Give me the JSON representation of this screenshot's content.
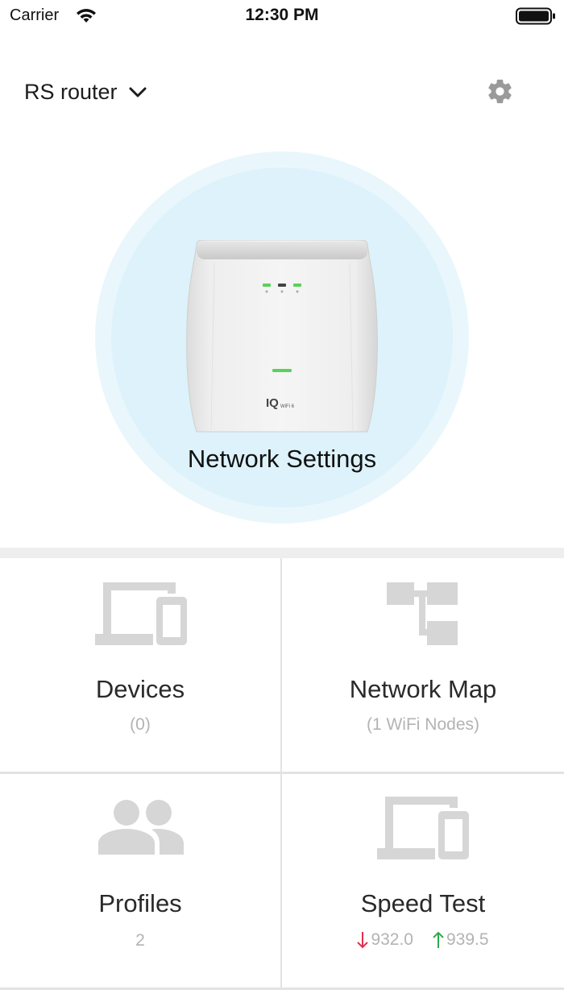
{
  "status_bar": {
    "carrier": "Carrier",
    "time": "12:30 PM",
    "icons": [
      "wifi-icon",
      "battery-icon"
    ]
  },
  "header": {
    "router_name": "RS router",
    "icons": [
      "chevron-down-icon",
      "gear-icon"
    ]
  },
  "hero": {
    "label": "Network Settings",
    "device_brand": "IQ",
    "device_model": "WiFi 6"
  },
  "tiles": {
    "devices": {
      "title": "Devices",
      "subtitle": "(0)",
      "icon": "devices-icon"
    },
    "network_map": {
      "title": "Network Map",
      "subtitle": "(1 WiFi Nodes)",
      "icon": "network-map-icon"
    },
    "profiles": {
      "title": "Profiles",
      "subtitle": "2",
      "icon": "profiles-icon"
    },
    "speed_test": {
      "title": "Speed Test",
      "download": "932.0",
      "upload": "939.5",
      "icon": "speed-test-devices-icon"
    }
  },
  "colors": {
    "accent_circle": "#ddf2fa",
    "icon_gray": "#d6d6d6",
    "download_arrow": "#e0304e",
    "upload_arrow": "#2eaa4a",
    "led_green": "#5cd05c"
  }
}
